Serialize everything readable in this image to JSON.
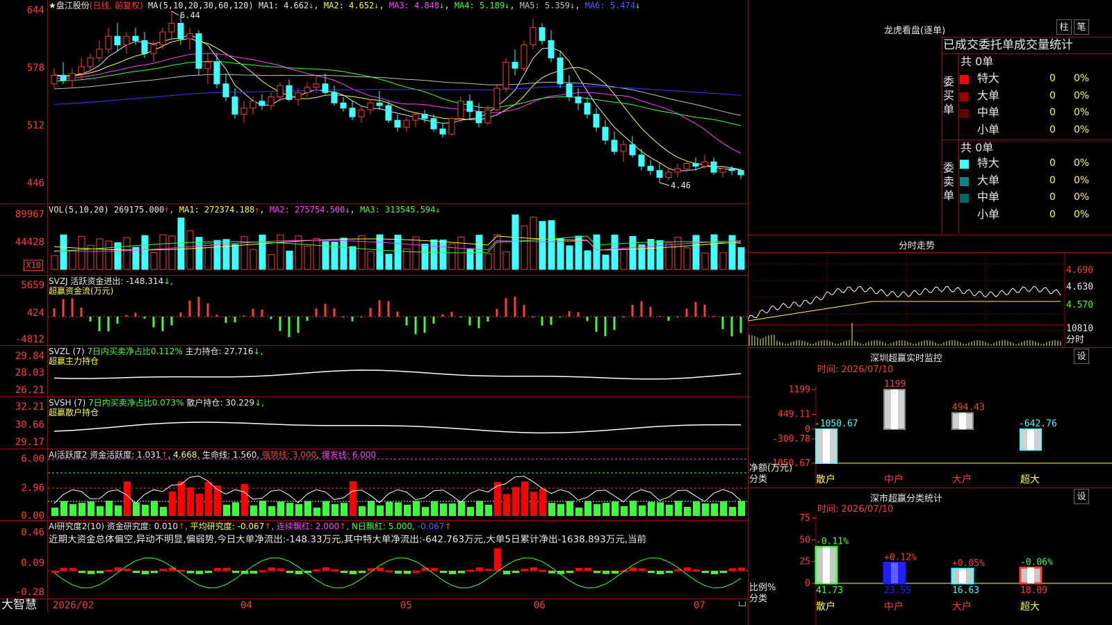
{
  "stock": {
    "star": "★",
    "name": "盘江股份",
    "mode": "(日线, 前复权)"
  },
  "main_chart": {
    "ma_header": "MA(5,10,20,30,60,120)",
    "ma": [
      {
        "label": "MA1:",
        "value": "4.662",
        "arrow": "↓",
        "color": "#e8e8e8"
      },
      {
        "label": "MA2:",
        "value": "4.652",
        "arrow": "↓",
        "color": "#ffff3b"
      },
      {
        "label": "MA3:",
        "value": "4.848",
        "arrow": "↓",
        "color": "#ff40ff"
      },
      {
        "label": "MA4:",
        "value": "5.189",
        "arrow": "↓",
        "color": "#3bff3b"
      },
      {
        "label": "MA5:",
        "value": "5.359",
        "arrow": "↓",
        "color": "#c0c0c0"
      },
      {
        "label": "MA6:",
        "value": "5.474",
        "arrow": "↓",
        "color": "#5a5aff"
      }
    ],
    "y_ticks": [
      "644",
      "578",
      "512",
      "446"
    ],
    "high_label": "6.44",
    "low_label": "4.46",
    "candles": [
      [
        5.6,
        5.78,
        5.55,
        5.7
      ],
      [
        5.7,
        5.85,
        5.6,
        5.64
      ],
      [
        5.64,
        5.78,
        5.55,
        5.72
      ],
      [
        5.72,
        5.9,
        5.65,
        5.8
      ],
      [
        5.8,
        5.95,
        5.75,
        5.9
      ],
      [
        5.9,
        6.1,
        5.85,
        6.0
      ],
      [
        6.0,
        6.25,
        5.95,
        6.15
      ],
      [
        6.15,
        6.3,
        5.98,
        6.05
      ],
      [
        6.05,
        6.2,
        5.95,
        6.15
      ],
      [
        6.15,
        6.25,
        6.05,
        6.1
      ],
      [
        6.1,
        6.2,
        5.9,
        5.95
      ],
      [
        5.95,
        6.1,
        5.85,
        6.05
      ],
      [
        6.05,
        6.25,
        6.0,
        6.2
      ],
      [
        6.2,
        6.44,
        6.1,
        6.3
      ],
      [
        6.3,
        6.38,
        6.05,
        6.12
      ],
      [
        6.12,
        6.25,
        6.0,
        6.18
      ],
      [
        6.18,
        6.22,
        5.7,
        5.78
      ],
      [
        5.78,
        5.95,
        5.6,
        5.85
      ],
      [
        5.85,
        5.95,
        5.55,
        5.6
      ],
      [
        5.6,
        5.72,
        5.4,
        5.45
      ],
      [
        5.45,
        5.55,
        5.2,
        5.25
      ],
      [
        5.25,
        5.4,
        5.15,
        5.32
      ],
      [
        5.32,
        5.45,
        5.25,
        5.4
      ],
      [
        5.4,
        5.48,
        5.3,
        5.35
      ],
      [
        5.35,
        5.5,
        5.3,
        5.45
      ],
      [
        5.45,
        5.62,
        5.4,
        5.58
      ],
      [
        5.58,
        5.65,
        5.4,
        5.42
      ],
      [
        5.42,
        5.55,
        5.35,
        5.5
      ],
      [
        5.5,
        5.62,
        5.45,
        5.56
      ],
      [
        5.56,
        5.7,
        5.5,
        5.6
      ],
      [
        5.6,
        5.72,
        5.48,
        5.5
      ],
      [
        5.5,
        5.58,
        5.35,
        5.38
      ],
      [
        5.38,
        5.45,
        5.28,
        5.32
      ],
      [
        5.32,
        5.4,
        5.18,
        5.22
      ],
      [
        5.22,
        5.35,
        5.15,
        5.3
      ],
      [
        5.3,
        5.42,
        5.25,
        5.38
      ],
      [
        5.38,
        5.52,
        5.3,
        5.35
      ],
      [
        5.35,
        5.4,
        5.15,
        5.18
      ],
      [
        5.18,
        5.25,
        5.05,
        5.1
      ],
      [
        5.1,
        5.22,
        5.05,
        5.18
      ],
      [
        5.18,
        5.28,
        5.1,
        5.25
      ],
      [
        5.25,
        5.3,
        5.15,
        5.2
      ],
      [
        5.2,
        5.25,
        5.05,
        5.08
      ],
      [
        5.08,
        5.15,
        4.98,
        5.02
      ],
      [
        5.02,
        5.22,
        5.0,
        5.2
      ],
      [
        5.2,
        5.45,
        5.15,
        5.4
      ],
      [
        5.4,
        5.48,
        5.2,
        5.28
      ],
      [
        5.28,
        5.38,
        5.1,
        5.15
      ],
      [
        5.15,
        5.35,
        5.12,
        5.3
      ],
      [
        5.3,
        5.6,
        5.28,
        5.55
      ],
      [
        5.55,
        5.9,
        5.5,
        5.85
      ],
      [
        5.85,
        6.0,
        5.7,
        5.78
      ],
      [
        5.78,
        6.1,
        5.75,
        6.05
      ],
      [
        6.05,
        6.35,
        6.0,
        6.25
      ],
      [
        6.25,
        6.3,
        6.05,
        6.1
      ],
      [
        6.1,
        6.22,
        5.85,
        5.9
      ],
      [
        5.9,
        5.98,
        5.55,
        5.6
      ],
      [
        5.6,
        5.7,
        5.4,
        5.45
      ],
      [
        5.45,
        5.55,
        5.3,
        5.38
      ],
      [
        5.38,
        5.45,
        5.2,
        5.25
      ],
      [
        5.25,
        5.32,
        5.05,
        5.1
      ],
      [
        5.1,
        5.18,
        4.9,
        4.95
      ],
      [
        4.95,
        5.05,
        4.78,
        4.82
      ],
      [
        4.82,
        4.95,
        4.7,
        4.9
      ],
      [
        4.9,
        5.0,
        4.75,
        4.78
      ],
      [
        4.78,
        4.85,
        4.6,
        4.65
      ],
      [
        4.65,
        4.72,
        4.55,
        4.6
      ],
      [
        4.6,
        4.68,
        4.46,
        4.52
      ],
      [
        4.52,
        4.62,
        4.48,
        4.58
      ],
      [
        4.58,
        4.68,
        4.52,
        4.62
      ],
      [
        4.62,
        4.72,
        4.58,
        4.68
      ],
      [
        4.68,
        4.75,
        4.6,
        4.65
      ],
      [
        4.65,
        4.78,
        4.62,
        4.7
      ],
      [
        4.7,
        4.75,
        4.55,
        4.58
      ],
      [
        4.58,
        4.65,
        4.52,
        4.62
      ],
      [
        4.62,
        4.65,
        4.55,
        4.6
      ],
      [
        4.6,
        4.62,
        4.5,
        4.55
      ]
    ]
  },
  "vol_panel": {
    "header": "VOL(5,10,20)",
    "value": "269175.000",
    "ma": [
      {
        "label": "MA1:",
        "value": "272374.188",
        "arrow": "↑",
        "color": "#ffff3b"
      },
      {
        "label": "MA2:",
        "value": "275754.500",
        "arrow": "↓",
        "color": "#ff40ff"
      },
      {
        "label": "MA3:",
        "value": "313545.594",
        "arrow": "↓",
        "color": "#3bff3b"
      }
    ],
    "first_arrow": "↑",
    "y_ticks": [
      "89967",
      "44428"
    ],
    "unit": "X10"
  },
  "svzj_panel": {
    "header": "SVZJ",
    "line1": "活跃资金进出: -148.314",
    "line1_arrow": "↓",
    "line2": "超赢资金流(万元)",
    "y_ticks": [
      "5659",
      "424",
      "-4812"
    ]
  },
  "svzl_panel": {
    "header": "SVZL (7)",
    "ratio": "7日内买卖净占比0.112%",
    "hold": "主力持仓: 27.716",
    "hold_arrow": "↓",
    "line2": "超赢主力持仓",
    "y_ticks": [
      "29.84",
      "28.03",
      "26.21"
    ]
  },
  "svsh_panel": {
    "header": "SVSH (7)",
    "ratio": "7日内买卖净占比0.073%",
    "hold": "散户持仓: 30.229",
    "hold_arrow": "↓",
    "line2": "超赢散户持仓",
    "y_ticks": [
      "32.21",
      "30.66",
      "29.17"
    ]
  },
  "ai_active_panel": {
    "header": "AI活跃度2",
    "activity": "资金活跃度: 1.031",
    "activity_arrow": "↑",
    "value2": "4.668",
    "life": "生命线: 1.560",
    "strong": "强势线: 3.000",
    "burst": "爆发线: 6.000",
    "y_ticks": [
      "6.00",
      "2.96",
      "0.00"
    ]
  },
  "ai_research_panel": {
    "header": "AI研究度2(10)",
    "research": "资金研究度: 0.010",
    "avg": "平均研究度: -0.067",
    "consec": "连续飘红: 2.000",
    "nday": "N日飘红: 5.000",
    "extra": "-0.067",
    "comment": "近期大资金总体偏空,异动不明显,偏弱势,今日大单净流出:-148.33万元,其中特大单净流出:-642.763万元,大单5日累计净出-1638.893万元,当前",
    "y_ticks": [
      "0.46",
      "0.09",
      "-0.28"
    ]
  },
  "date_axis": {
    "labels": [
      "2026/02",
      "04",
      "05",
      "06",
      "07"
    ]
  },
  "footer": {
    "logo": "大智慧"
  },
  "right_top": {
    "title": "龙虎看盘(逐单)",
    "btn1": "柱",
    "btn2": "笔",
    "subtitle": "已成交委托单成交量统计",
    "buy": {
      "label": "委买单",
      "count": "共 0单",
      "rows": [
        {
          "name": "特大",
          "color": "#ff0000",
          "n": "0",
          "pct": "0%"
        },
        {
          "name": "大单",
          "color": "#990000",
          "n": "0",
          "pct": "0%"
        },
        {
          "name": "中单",
          "color": "#660000",
          "n": "0",
          "pct": "0%"
        },
        {
          "name": "小单",
          "color": "",
          "n": "0",
          "pct": "0%"
        }
      ]
    },
    "sell": {
      "label": "委卖单",
      "count": "共 0单",
      "rows": [
        {
          "name": "特大",
          "color": "#40ffff",
          "n": "0",
          "pct": "0%"
        },
        {
          "name": "大单",
          "color": "#008888",
          "n": "0",
          "pct": "0%"
        },
        {
          "name": "中单",
          "color": "#006666",
          "n": "0",
          "pct": "0%"
        },
        {
          "name": "小单",
          "color": "",
          "n": "0",
          "pct": "0%"
        }
      ]
    }
  },
  "intraday": {
    "title": "分时走势",
    "y_labels": [
      "4.690",
      "4.630",
      "4.570"
    ],
    "vol_label": "10810",
    "bottom_label": "分时"
  },
  "sz_monitor": {
    "title": "深圳超赢实时监控",
    "settings": "设",
    "time": "时间: 2026/07/10",
    "y_ticks": [
      "1199",
      "449.11",
      "0",
      "-300.78",
      "-1050.67"
    ],
    "ylabel": "净额(万元)",
    "xlabel": "分类",
    "bars": [
      {
        "cat": "散户",
        "value": -1050.67,
        "label": "-1050.67"
      },
      {
        "cat": "中户",
        "value": 1199,
        "label": "1199"
      },
      {
        "cat": "大户",
        "value": 494.43,
        "label": "494.43"
      },
      {
        "cat": "超大",
        "value": -642.76,
        "label": "-642.76"
      }
    ]
  },
  "sz_class": {
    "title": "深市超赢分类统计",
    "settings": "设",
    "time": "时间: 2026/07/10",
    "y_ticks": [
      "75",
      "50",
      "25",
      "0"
    ],
    "ylabel": "比例%",
    "xlabel": "分类",
    "bars": [
      {
        "cat": "散户",
        "value": 41.73,
        "change": "-0.11%"
      },
      {
        "cat": "中户",
        "value": 23.55,
        "change": "+0.12%"
      },
      {
        "cat": "大户",
        "value": 16.63,
        "change": "+0.05%"
      },
      {
        "cat": "超大",
        "value": 18.09,
        "change": "-0.06%"
      }
    ]
  }
}
